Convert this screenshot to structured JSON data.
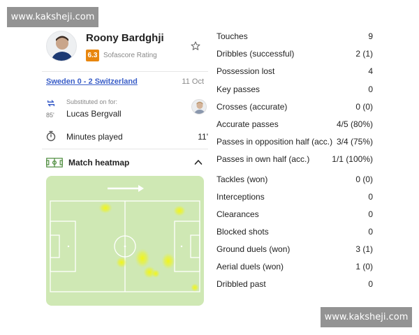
{
  "watermark": {
    "text": "www.kaksheji.com"
  },
  "player": {
    "name": "Roony Bardghji",
    "rating": "6.3",
    "rating_label": "Sofascore Rating"
  },
  "match": {
    "title": "Sweden 0 - 2 Switzerland",
    "date": "11 Oct"
  },
  "substitution": {
    "label": "Substituted on for:",
    "minute": "85'",
    "player": "Lucas Bergvall"
  },
  "minutes_played": {
    "label": "Minutes played",
    "value": "11'"
  },
  "heatmap": {
    "title": "Match heatmap"
  },
  "stats": [
    {
      "label": "Touches",
      "value": "9"
    },
    {
      "label": "Dribbles (successful)",
      "value": "2 (1)"
    },
    {
      "label": "Possession lost",
      "value": "4"
    },
    {
      "label": "Key passes",
      "value": "0"
    },
    {
      "label": "Crosses (accurate)",
      "value": "0 (0)"
    },
    {
      "label": "Accurate passes",
      "value": "4/5 (80%)"
    },
    {
      "label": "Passes in opposition half (acc.)",
      "value": "3/4 (75%)"
    },
    {
      "label": "Passes in own half (acc.)",
      "value": "1/1 (100%)"
    },
    {
      "label": "Tackles (won)",
      "value": "0 (0)"
    },
    {
      "label": "Interceptions",
      "value": "0"
    },
    {
      "label": "Clearances",
      "value": "0"
    },
    {
      "label": "Blocked shots",
      "value": "0"
    },
    {
      "label": "Ground duels (won)",
      "value": "3 (1)"
    },
    {
      "label": "Aerial duels (won)",
      "value": "1 (0)"
    },
    {
      "label": "Dribbled past",
      "value": "0"
    }
  ],
  "colors": {
    "accent_link": "#3a5ec8",
    "rating_badge": "#e8860e",
    "pitch": "#cfe8b4",
    "heat": "#e8f020"
  }
}
